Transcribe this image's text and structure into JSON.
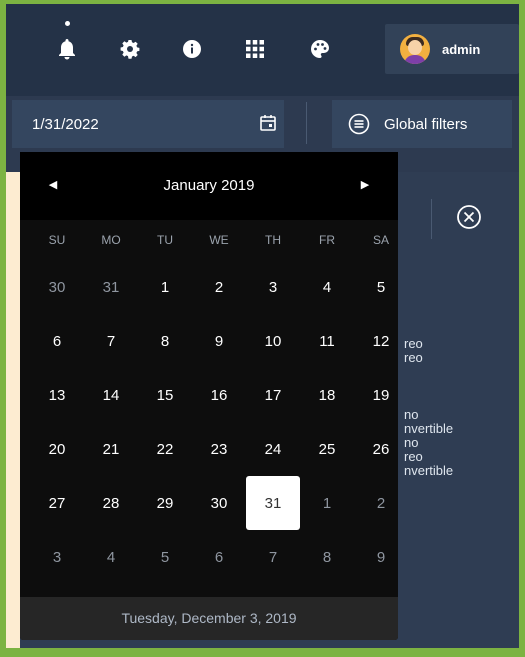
{
  "user": {
    "name": "admin"
  },
  "date_input": {
    "value": "1/31/2022"
  },
  "global_filters": {
    "label": "Global filters"
  },
  "calendar": {
    "month_title": "January 2019",
    "prev_glyph": "◀",
    "next_glyph": "▶",
    "weekdays": [
      "SU",
      "MO",
      "TU",
      "WE",
      "TH",
      "FR",
      "SA"
    ],
    "weeks": [
      [
        {
          "d": "30",
          "m": true
        },
        {
          "d": "31",
          "m": true
        },
        {
          "d": "1"
        },
        {
          "d": "2"
        },
        {
          "d": "3"
        },
        {
          "d": "4"
        },
        {
          "d": "5"
        }
      ],
      [
        {
          "d": "6"
        },
        {
          "d": "7"
        },
        {
          "d": "8"
        },
        {
          "d": "9"
        },
        {
          "d": "10"
        },
        {
          "d": "11"
        },
        {
          "d": "12"
        }
      ],
      [
        {
          "d": "13"
        },
        {
          "d": "14"
        },
        {
          "d": "15"
        },
        {
          "d": "16"
        },
        {
          "d": "17"
        },
        {
          "d": "18"
        },
        {
          "d": "19"
        }
      ],
      [
        {
          "d": "20"
        },
        {
          "d": "21"
        },
        {
          "d": "22"
        },
        {
          "d": "23"
        },
        {
          "d": "24"
        },
        {
          "d": "25"
        },
        {
          "d": "26"
        }
      ],
      [
        {
          "d": "27"
        },
        {
          "d": "28"
        },
        {
          "d": "29"
        },
        {
          "d": "30"
        },
        {
          "d": "31",
          "selected": true
        },
        {
          "d": "1",
          "m": true
        },
        {
          "d": "2",
          "m": true
        }
      ],
      [
        {
          "d": "3",
          "m": true
        },
        {
          "d": "4",
          "m": true
        },
        {
          "d": "5",
          "m": true
        },
        {
          "d": "6",
          "m": true
        },
        {
          "d": "7",
          "m": true
        },
        {
          "d": "8",
          "m": true
        },
        {
          "d": "9",
          "m": true
        }
      ]
    ],
    "footer": "Tuesday, December 3, 2019"
  },
  "background_text": [
    "reo",
    "reo",
    "no",
    "nvertible",
    "no",
    "reo",
    "nvertible"
  ],
  "icons": {
    "bell": "bell-icon",
    "gear": "gear-icon",
    "info": "info-icon",
    "apps": "apps-grid-icon",
    "palette": "palette-icon",
    "calendar": "calendar-icon",
    "filter": "filter-list-icon",
    "close": "close-circle-icon"
  }
}
